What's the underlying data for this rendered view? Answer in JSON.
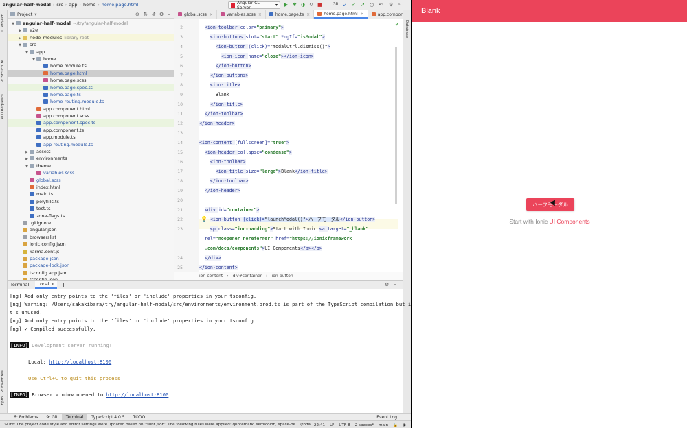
{
  "ide": {
    "breadcrumb": [
      "angular-half-modal",
      "src",
      "app",
      "home",
      "home.page.html"
    ],
    "run_config": "Angular CLI Server",
    "git_label": "Git:",
    "project_header": "Project",
    "tree": [
      {
        "label": "angular-half-modal",
        "extra": "~/try/angular-half-modal",
        "depth": 0,
        "type": "folder",
        "open": true,
        "bold": true
      },
      {
        "label": "e2e",
        "depth": 1,
        "type": "folder",
        "open": false
      },
      {
        "label": "node_modules",
        "extra": "library root",
        "depth": 1,
        "type": "yfolder",
        "open": false,
        "style": "lib"
      },
      {
        "label": "src",
        "depth": 1,
        "type": "folder",
        "open": true
      },
      {
        "label": "app",
        "depth": 2,
        "type": "folder",
        "open": true
      },
      {
        "label": "home",
        "depth": 3,
        "type": "folder",
        "open": true
      },
      {
        "label": "home.module.ts",
        "depth": 4,
        "type": "ts"
      },
      {
        "label": "home.page.html",
        "depth": 4,
        "type": "html",
        "style": "sel",
        "color": "blue"
      },
      {
        "label": "home.page.scss",
        "depth": 4,
        "type": "scss"
      },
      {
        "label": "home.page.spec.ts",
        "depth": 4,
        "type": "ts",
        "style": "mod",
        "color": "blue"
      },
      {
        "label": "home.page.ts",
        "depth": 4,
        "type": "ts",
        "color": "blue"
      },
      {
        "label": "home-routing.module.ts",
        "depth": 4,
        "type": "ts",
        "color": "blue"
      },
      {
        "label": "app.component.html",
        "depth": 3,
        "type": "html"
      },
      {
        "label": "app.component.scss",
        "depth": 3,
        "type": "scss"
      },
      {
        "label": "app.component.spec.ts",
        "depth": 3,
        "type": "ts",
        "style": "mod",
        "color": "blue"
      },
      {
        "label": "app.component.ts",
        "depth": 3,
        "type": "ts"
      },
      {
        "label": "app.module.ts",
        "depth": 3,
        "type": "ts"
      },
      {
        "label": "app-routing.module.ts",
        "depth": 3,
        "type": "ts",
        "color": "blue"
      },
      {
        "label": "assets",
        "depth": 2,
        "type": "folder",
        "open": false
      },
      {
        "label": "environments",
        "depth": 2,
        "type": "folder",
        "open": false
      },
      {
        "label": "theme",
        "depth": 2,
        "type": "folder",
        "open": true
      },
      {
        "label": "variables.scss",
        "depth": 3,
        "type": "scss",
        "color": "blue"
      },
      {
        "label": "global.scss",
        "depth": 2,
        "type": "scss",
        "color": "blue"
      },
      {
        "label": "index.html",
        "depth": 2,
        "type": "html"
      },
      {
        "label": "main.ts",
        "depth": 2,
        "type": "ts"
      },
      {
        "label": "polyfills.ts",
        "depth": 2,
        "type": "ts"
      },
      {
        "label": "test.ts",
        "depth": 2,
        "type": "ts"
      },
      {
        "label": "zone-flags.ts",
        "depth": 2,
        "type": "ts"
      },
      {
        "label": ".gitignore",
        "depth": 1,
        "type": "txt"
      },
      {
        "label": "angular.json",
        "depth": 1,
        "type": "json"
      },
      {
        "label": "browserslist",
        "depth": 1,
        "type": "txt"
      },
      {
        "label": "ionic.config.json",
        "depth": 1,
        "type": "json"
      },
      {
        "label": "karma.conf.js",
        "depth": 1,
        "type": "js"
      },
      {
        "label": "package.json",
        "depth": 1,
        "type": "json",
        "color": "blue"
      },
      {
        "label": "package-lock.json",
        "depth": 1,
        "type": "json",
        "color": "blue"
      },
      {
        "label": "tsconfig.app.json",
        "depth": 1,
        "type": "json"
      },
      {
        "label": "tsconfig.json",
        "depth": 1,
        "type": "json"
      }
    ],
    "tabs": [
      {
        "label": "global.scss",
        "type": "scss"
      },
      {
        "label": "variables.scss",
        "type": "scss"
      },
      {
        "label": "home.page.ts",
        "type": "ts"
      },
      {
        "label": "home.page.html",
        "type": "html",
        "active": true
      },
      {
        "label": "app.component.html",
        "type": "html"
      }
    ],
    "editor_breadcrumb": [
      "ion-content",
      "div#container",
      "ion-button"
    ],
    "terminal": {
      "label": "Terminal:",
      "tab": "Local",
      "add": "+",
      "lines": [
        "[ng] Add only entry points to the 'files' or 'include' properties in your tsconfig.",
        "[ng] Warning: /Users/sakakibara/try/angular-half-modal/src/environments/environment.prod.ts is part of the TypeScript compilation but i",
        "t's unused.",
        "[ng] Add only entry points to the 'files' or 'include' properties in your tsconfig.",
        "[ng] ✔ Compiled successfully."
      ],
      "info_badge": "[INFO]",
      "dev_running": "Development server running!",
      "local_label": "Local: ",
      "local_url": "http://localhost:8100",
      "quit_hint": "Use Ctrl+C to quit this process",
      "browser_opened": "Browser window opened to ",
      "browser_url": "http://localhost:8100",
      "browser_end": "!"
    },
    "bottom_tabs": [
      "6: Problems",
      "9: Git",
      "Terminal",
      "TypeScript 4.0.5",
      "TODO"
    ],
    "event_log": "Event Log",
    "status_msg": "TSLint: The project code style and editor settings were updated based on 'tslint.json'. The following rules were applied: quotemark, semicolon, space-be... (today 19:33",
    "status_right": [
      "22:41",
      "LF",
      "UTF-8",
      "2 spaces*",
      "main"
    ],
    "side_left": [
      "1: Project",
      "2: Structure",
      "Pull Requests",
      "2: Favorites",
      "npm"
    ],
    "side_right": "Database"
  },
  "preview": {
    "toolbar_title": "Blank",
    "button_label": "ハーフモーダル",
    "text_prefix": "Start with Ionic ",
    "text_link": "UI Components",
    "accent": "#eb445a"
  }
}
